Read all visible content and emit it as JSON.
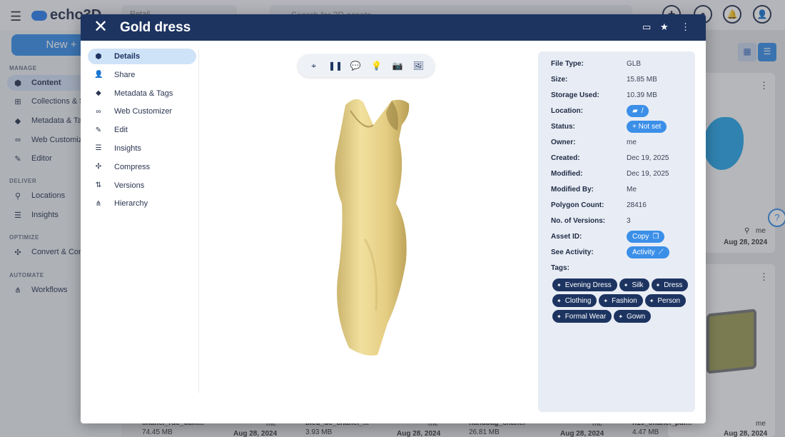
{
  "app": {
    "logo": "echo3D",
    "project_select": "Retail",
    "search_placeholder": "Search for 3D assets",
    "new_button": "New +",
    "sidebar": {
      "sections": [
        {
          "title": "MANAGE"
        },
        {
          "title": "DELIVER"
        },
        {
          "title": "OPTIMIZE"
        },
        {
          "title": "AUTOMATE"
        }
      ],
      "items": [
        {
          "label": "Content",
          "icon": "cube-icon"
        },
        {
          "label": "Collections & Sets",
          "icon": "grid-icon"
        },
        {
          "label": "Metadata & Tags",
          "icon": "tag-icon"
        },
        {
          "label": "Web Customizer",
          "icon": "glasses-icon"
        },
        {
          "label": "Editor",
          "icon": "pencil-icon"
        },
        {
          "label": "Locations",
          "icon": "map-pin-icon"
        },
        {
          "label": "Insights",
          "icon": "bar-chart-icon"
        },
        {
          "label": "Convert & Compress",
          "icon": "compress-icon"
        },
        {
          "label": "Workflows",
          "icon": "workflow-icon"
        }
      ]
    },
    "cards": [
      {
        "title": "chanel_rue_cam...",
        "size": "74.45 MB",
        "owner": "me",
        "date": "Aug 28, 2024"
      },
      {
        "title": "bleu_de_chanel_...",
        "size": "3.93 MB",
        "owner": "me",
        "date": "Aug 28, 2024"
      },
      {
        "title": "handbag_chanel",
        "size": "26.81 MB",
        "owner": "me",
        "date": "Aug 28, 2024"
      },
      {
        "title": "n19_chanel_par...",
        "size": "4.47 MB",
        "owner": "me",
        "date": "Aug 28, 2024"
      }
    ],
    "right_card": {
      "owner": "me",
      "date": "Aug 28, 2024"
    }
  },
  "modal": {
    "title": "Gold dress",
    "nav": [
      {
        "label": "Details",
        "icon": "cube-icon",
        "active": true
      },
      {
        "label": "Share",
        "icon": "person-add-icon"
      },
      {
        "label": "Metadata & Tags",
        "icon": "tag-icon"
      },
      {
        "label": "Web Customizer",
        "icon": "glasses-icon"
      },
      {
        "label": "Edit",
        "icon": "pencil-icon"
      },
      {
        "label": "Insights",
        "icon": "bar-chart-icon"
      },
      {
        "label": "Compress",
        "icon": "compress-icon"
      },
      {
        "label": "Versions",
        "icon": "versions-icon"
      },
      {
        "label": "Hierarchy",
        "icon": "hierarchy-icon"
      }
    ],
    "viewer_toolbar": [
      "crosshair-icon",
      "pause-icon",
      "chat-icon",
      "lightbulb-icon",
      "camera-icon",
      "image-icon"
    ],
    "details": {
      "file_type": {
        "label": "File Type:",
        "value": "GLB"
      },
      "size": {
        "label": "Size:",
        "value": "15.85 MB"
      },
      "storage_used": {
        "label": "Storage Used:",
        "value": "10.39 MB"
      },
      "location": {
        "label": "Location:",
        "value": "/"
      },
      "status": {
        "label": "Status:",
        "value": "+ Not set"
      },
      "owner": {
        "label": "Owner:",
        "value": "me"
      },
      "created": {
        "label": "Created:",
        "value": "Dec 19, 2025"
      },
      "modified": {
        "label": "Modified:",
        "value": "Dec 19, 2025"
      },
      "modified_by": {
        "label": "Modified By:",
        "value": "Me"
      },
      "polygon_count": {
        "label": "Polygon Count:",
        "value": "28416"
      },
      "versions": {
        "label": "No. of Versions:",
        "value": "3"
      },
      "asset_id": {
        "label": "Asset ID:",
        "value": "Copy"
      },
      "activity": {
        "label": "See Activity:",
        "value": "Activity"
      },
      "tags_label": "Tags:"
    },
    "tags": [
      "Evening Dress",
      "Silk",
      "Dress",
      "Clothing",
      "Fashion",
      "Person",
      "Formal Wear",
      "Gown"
    ]
  },
  "colors": {
    "header": "#1d3461",
    "accent": "#3b8fe8",
    "tag": "#1d3461",
    "dress": "#e8d48a"
  }
}
